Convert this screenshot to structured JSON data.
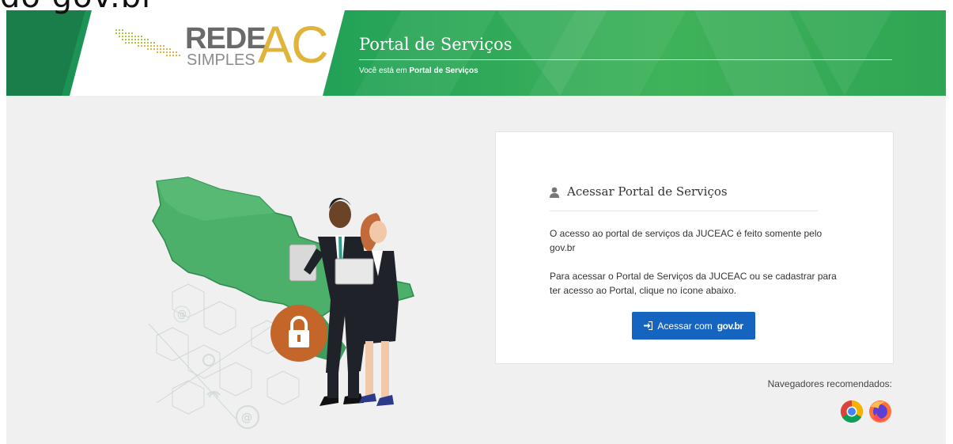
{
  "caption": {
    "text": "do gov.br"
  },
  "header": {
    "logo": {
      "rede": "REDE",
      "simples": "SIMPLES",
      "ac": "AC"
    },
    "title": "Portal de Serviços",
    "breadcrumb_prefix": "Você está em",
    "breadcrumb_current": "Portal de Serviços"
  },
  "card": {
    "title": "Acessar Portal de Serviços",
    "paragraph1": "O acesso ao portal de serviços da JUCEAC é feito somente pelo gov.br",
    "paragraph2": "Para acessar o Portal de Serviços da JUCEAC ou se cadastrar para ter acesso ao Portal, clique no ícone abaixo.",
    "button_label": "Acessar com",
    "button_logo": "gov.br"
  },
  "browsers": {
    "label": "Navegadores recomendados:",
    "items": [
      "chrome-icon",
      "firefox-icon"
    ]
  },
  "colors": {
    "header_green": "#23a257",
    "button_blue": "#1565c0",
    "logo_gold": "#e0b43a",
    "map_green": "#4caf6a",
    "lock_orange": "#c4662a"
  }
}
